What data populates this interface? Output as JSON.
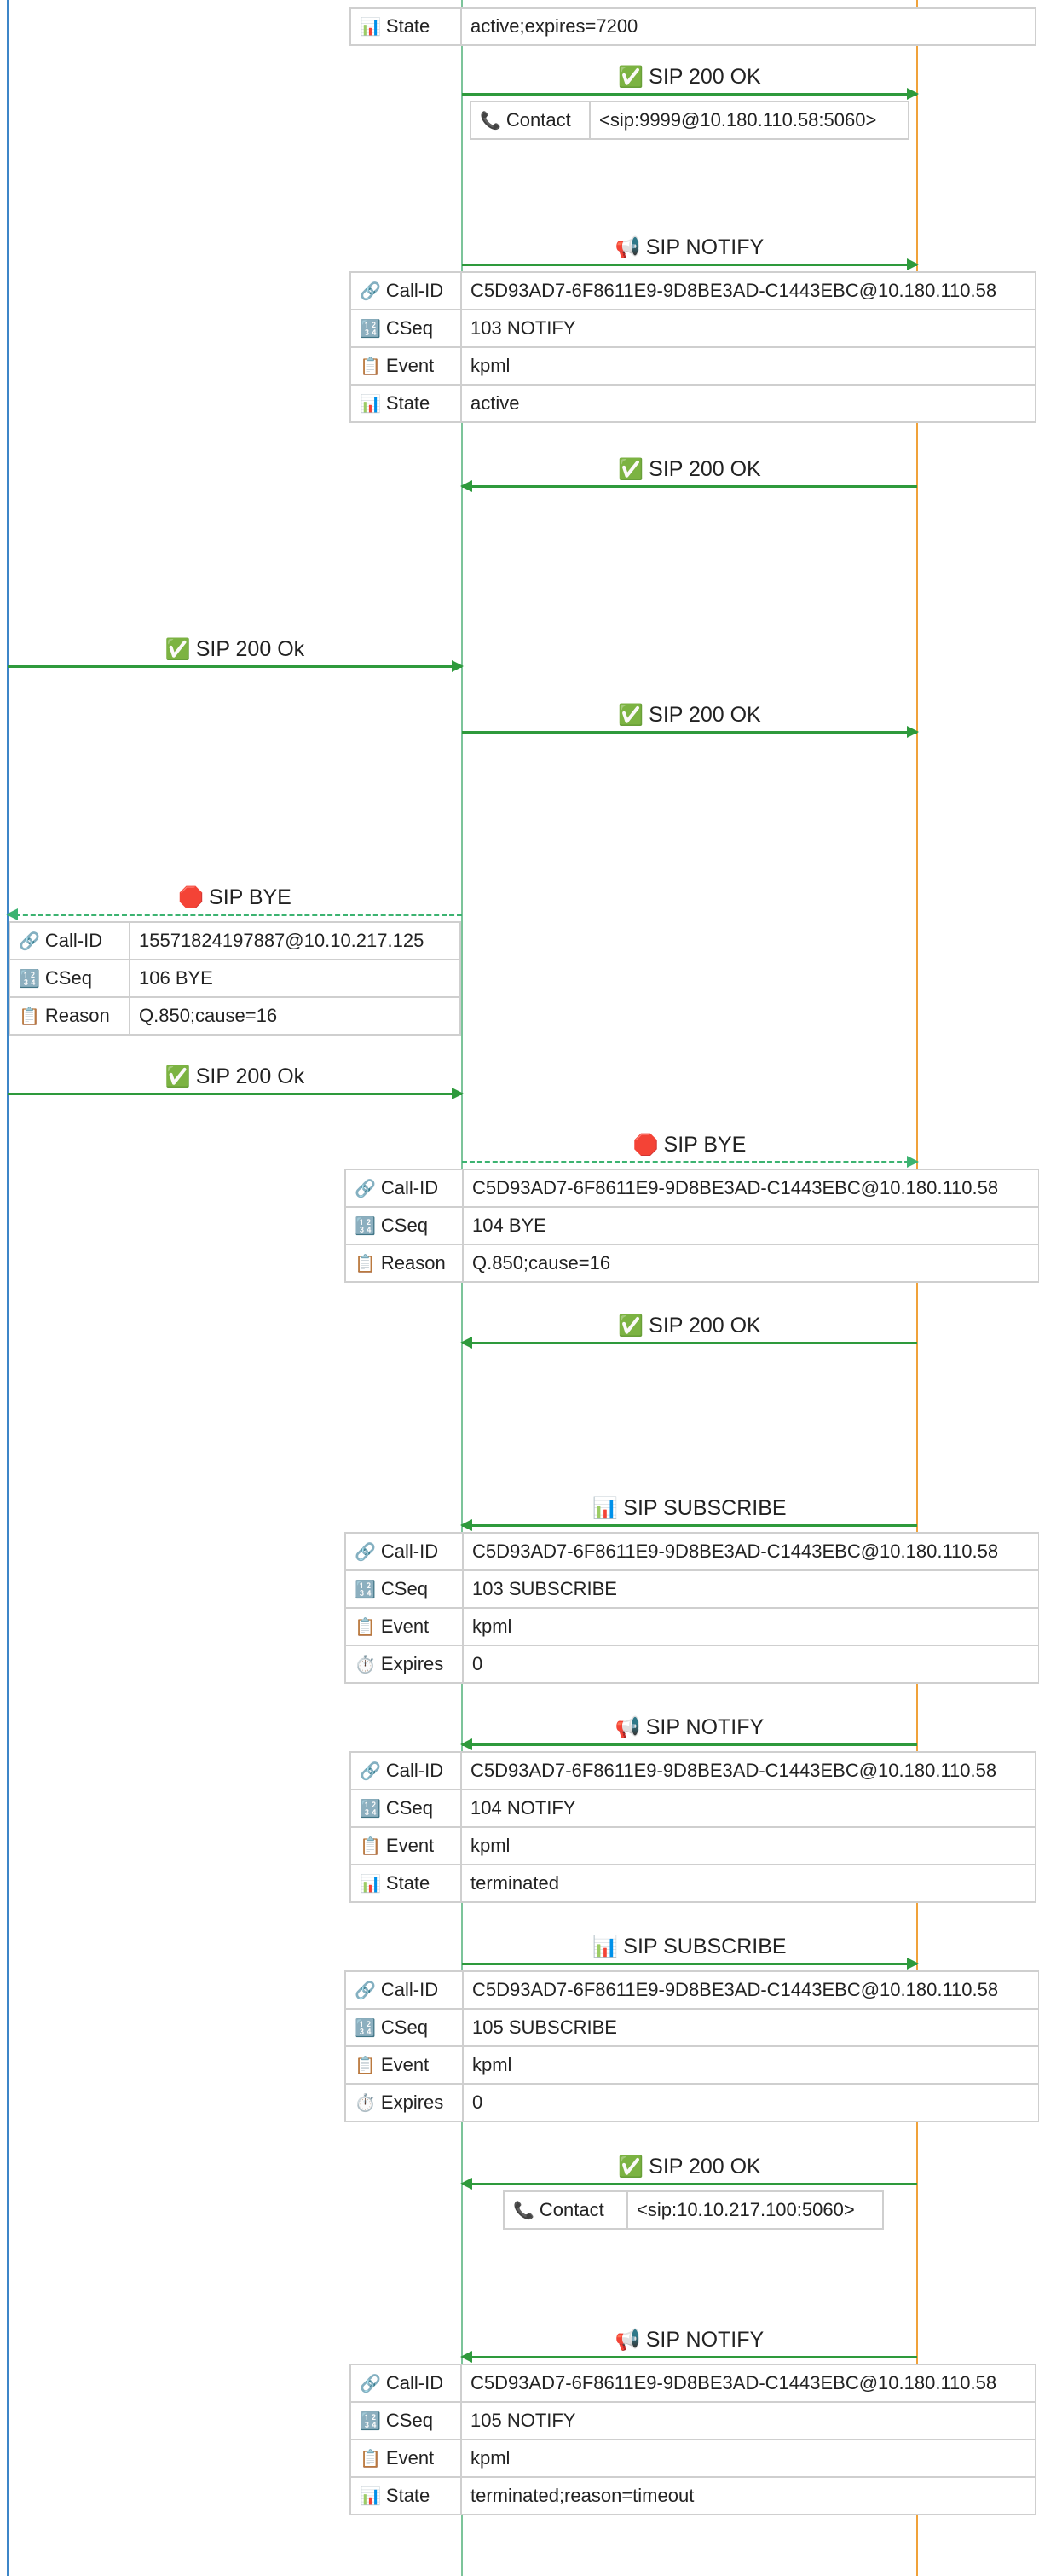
{
  "colors": {
    "lifeline_a": "#3d86c8",
    "lifeline_b": "#7cc49a",
    "lifeline_c": "#f0a23a",
    "arrow_green": "#2e9a3c",
    "arrow_dashed": "#3cb371",
    "cell_border": "#cfcfcf"
  },
  "messages": [
    {
      "label": "SIP 200 OK",
      "icon": "✅",
      "icon_name": "check-mark-icon",
      "dir": "right",
      "from": "b",
      "to": "c",
      "dashed": false
    },
    {
      "label": "SIP NOTIFY",
      "icon": "📢",
      "icon_name": "megaphone-icon",
      "dir": "right",
      "from": "b",
      "to": "c",
      "dashed": false
    },
    {
      "label": "SIP 200 OK",
      "icon": "✅",
      "icon_name": "check-mark-icon",
      "dir": "left",
      "from": "c",
      "to": "b",
      "dashed": false
    },
    {
      "label": "SIP 200 Ok",
      "icon": "✅",
      "icon_name": "check-mark-icon",
      "dir": "right",
      "from": "a",
      "to": "b",
      "dashed": false
    },
    {
      "label": "SIP 200 OK",
      "icon": "✅",
      "icon_name": "check-mark-icon",
      "dir": "right",
      "from": "b",
      "to": "c",
      "dashed": false
    },
    {
      "label": "SIP BYE",
      "icon": "🛑",
      "icon_name": "stop-sign-icon",
      "dir": "left",
      "from": "b",
      "to": "a",
      "dashed": true
    },
    {
      "label": "SIP 200 Ok",
      "icon": "✅",
      "icon_name": "check-mark-icon",
      "dir": "right",
      "from": "a",
      "to": "b",
      "dashed": false
    },
    {
      "label": "SIP BYE",
      "icon": "🛑",
      "icon_name": "stop-sign-icon",
      "dir": "right",
      "from": "b",
      "to": "c",
      "dashed": true
    },
    {
      "label": "SIP 200 OK",
      "icon": "✅",
      "icon_name": "check-mark-icon",
      "dir": "left",
      "from": "c",
      "to": "b",
      "dashed": false
    },
    {
      "label": "SIP SUBSCRIBE",
      "icon": "📊",
      "icon_name": "bar-chart-icon",
      "dir": "left",
      "from": "c",
      "to": "b",
      "dashed": false
    },
    {
      "label": "SIP NOTIFY",
      "icon": "📢",
      "icon_name": "megaphone-icon",
      "dir": "left",
      "from": "c",
      "to": "b",
      "dashed": false
    },
    {
      "label": "SIP SUBSCRIBE",
      "icon": "📊",
      "icon_name": "bar-chart-icon",
      "dir": "right",
      "from": "b",
      "to": "c",
      "dashed": false
    },
    {
      "label": "SIP 200 OK",
      "icon": "✅",
      "icon_name": "check-mark-icon",
      "dir": "left",
      "from": "c",
      "to": "b",
      "dashed": false
    },
    {
      "label": "SIP NOTIFY",
      "icon": "📢",
      "icon_name": "megaphone-icon",
      "dir": "left",
      "from": "c",
      "to": "b",
      "dashed": false
    }
  ],
  "tables": [
    {
      "rows": [
        {
          "icon": "📊",
          "icon_name": "bar-chart-icon",
          "key": "State",
          "value": "active;expires=7200"
        }
      ]
    },
    {
      "rows": [
        {
          "icon": "📞",
          "icon_name": "telephone-icon",
          "key": "Contact",
          "value": "<sip:9999@10.180.110.58:5060>"
        }
      ]
    },
    {
      "rows": [
        {
          "icon": "🔗",
          "icon_name": "link-icon",
          "key": "Call-ID",
          "value": "C5D93AD7-6F8611E9-9D8BE3AD-C1443EBC@10.180.110.58"
        },
        {
          "icon": "🔢",
          "icon_name": "numbers-icon",
          "key": "CSeq",
          "value": "103 NOTIFY"
        },
        {
          "icon": "📋",
          "icon_name": "clipboard-icon",
          "key": "Event",
          "value": "kpml"
        },
        {
          "icon": "📊",
          "icon_name": "bar-chart-icon",
          "key": "State",
          "value": "active"
        }
      ]
    },
    {
      "rows": [
        {
          "icon": "🔗",
          "icon_name": "link-icon",
          "key": "Call-ID",
          "value": "15571824197887@10.10.217.125"
        },
        {
          "icon": "🔢",
          "icon_name": "numbers-icon",
          "key": "CSeq",
          "value": "106 BYE"
        },
        {
          "icon": "📋",
          "icon_name": "clipboard-icon",
          "key": "Reason",
          "value": "Q.850;cause=16"
        }
      ]
    },
    {
      "rows": [
        {
          "icon": "🔗",
          "icon_name": "link-icon",
          "key": "Call-ID",
          "value": "C5D93AD7-6F8611E9-9D8BE3AD-C1443EBC@10.180.110.58"
        },
        {
          "icon": "🔢",
          "icon_name": "numbers-icon",
          "key": "CSeq",
          "value": "104 BYE"
        },
        {
          "icon": "📋",
          "icon_name": "clipboard-icon",
          "key": "Reason",
          "value": "Q.850;cause=16"
        }
      ]
    },
    {
      "rows": [
        {
          "icon": "🔗",
          "icon_name": "link-icon",
          "key": "Call-ID",
          "value": "C5D93AD7-6F8611E9-9D8BE3AD-C1443EBC@10.180.110.58"
        },
        {
          "icon": "🔢",
          "icon_name": "numbers-icon",
          "key": "CSeq",
          "value": "103 SUBSCRIBE"
        },
        {
          "icon": "📋",
          "icon_name": "clipboard-icon",
          "key": "Event",
          "value": "kpml"
        },
        {
          "icon": "⏱️",
          "icon_name": "stopwatch-icon",
          "key": "Expires",
          "value": "0"
        }
      ]
    },
    {
      "rows": [
        {
          "icon": "🔗",
          "icon_name": "link-icon",
          "key": "Call-ID",
          "value": "C5D93AD7-6F8611E9-9D8BE3AD-C1443EBC@10.180.110.58"
        },
        {
          "icon": "🔢",
          "icon_name": "numbers-icon",
          "key": "CSeq",
          "value": "104 NOTIFY"
        },
        {
          "icon": "📋",
          "icon_name": "clipboard-icon",
          "key": "Event",
          "value": "kpml"
        },
        {
          "icon": "📊",
          "icon_name": "bar-chart-icon",
          "key": "State",
          "value": "terminated"
        }
      ]
    },
    {
      "rows": [
        {
          "icon": "🔗",
          "icon_name": "link-icon",
          "key": "Call-ID",
          "value": "C5D93AD7-6F8611E9-9D8BE3AD-C1443EBC@10.180.110.58"
        },
        {
          "icon": "🔢",
          "icon_name": "numbers-icon",
          "key": "CSeq",
          "value": "105 SUBSCRIBE"
        },
        {
          "icon": "📋",
          "icon_name": "clipboard-icon",
          "key": "Event",
          "value": "kpml"
        },
        {
          "icon": "⏱️",
          "icon_name": "stopwatch-icon",
          "key": "Expires",
          "value": "0"
        }
      ]
    },
    {
      "rows": [
        {
          "icon": "📞",
          "icon_name": "telephone-icon",
          "key": "Contact",
          "value": "<sip:10.10.217.100:5060>"
        }
      ]
    },
    {
      "rows": [
        {
          "icon": "🔗",
          "icon_name": "link-icon",
          "key": "Call-ID",
          "value": "C5D93AD7-6F8611E9-9D8BE3AD-C1443EBC@10.180.110.58"
        },
        {
          "icon": "🔢",
          "icon_name": "numbers-icon",
          "key": "CSeq",
          "value": "105 NOTIFY"
        },
        {
          "icon": "📋",
          "icon_name": "clipboard-icon",
          "key": "Event",
          "value": "kpml"
        },
        {
          "icon": "📊",
          "icon_name": "bar-chart-icon",
          "key": "State",
          "value": "terminated;reason=timeout"
        }
      ]
    }
  ]
}
